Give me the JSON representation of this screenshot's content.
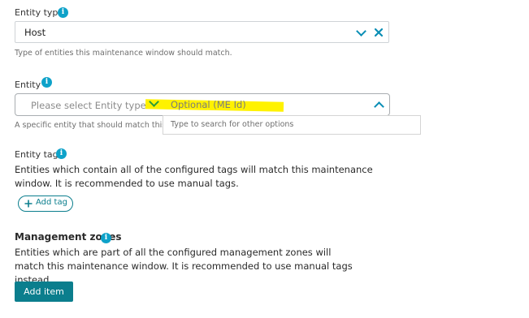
{
  "entity_type": {
    "label": "Entity type",
    "value": "Host",
    "hint": "Type of entities this maintenance window should match."
  },
  "entity": {
    "label": "Entity",
    "placeholder_type": "Please select Entity type",
    "placeholder_id": "Optional (ME Id)",
    "hint": "A specific entity that should match this ma",
    "search_placeholder": "Type to search for other options"
  },
  "entity_tags": {
    "label": "Entity tags",
    "description": "Entities which contain all of the configured tags will match this maintenance window. It is recommended to use manual tags.",
    "add_tag_label": "Add tag"
  },
  "management_zones": {
    "label": "Management zones",
    "description": "Entities which are part of all the configured management zones will match this maintenance window. It is recommended to use manual tags instead.",
    "add_item_label": "Add item"
  },
  "colors": {
    "accent": "#0ea2c9",
    "button": "#0b7e8d",
    "highlight": "#fff200"
  }
}
